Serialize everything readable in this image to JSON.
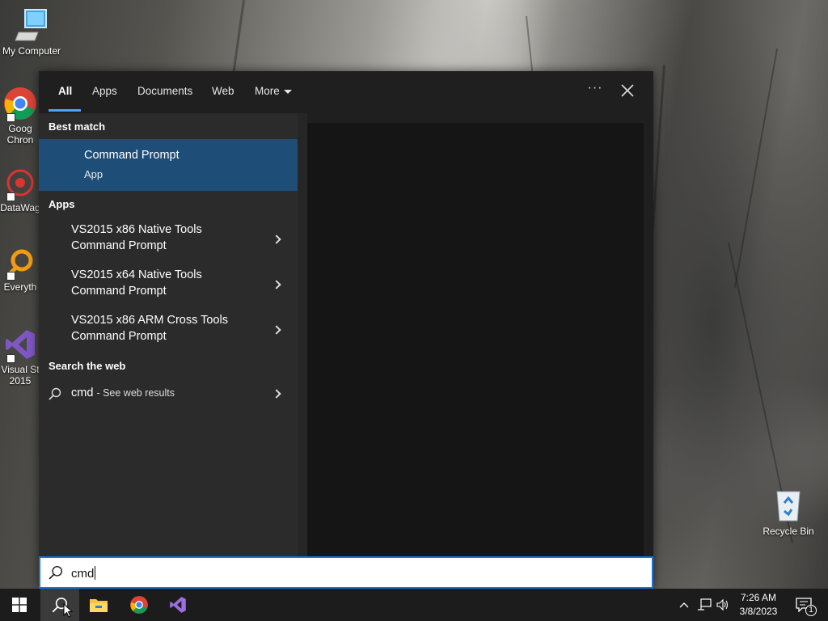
{
  "desktop": {
    "icons": [
      {
        "label": "My Computer"
      },
      {
        "label": "Goog Chron"
      },
      {
        "label": "DataWag"
      },
      {
        "label": "Everyth"
      },
      {
        "label": "Visual St 2015"
      },
      {
        "label": "Recycle Bin"
      }
    ]
  },
  "search_panel": {
    "tabs": [
      {
        "label": "All",
        "active": true
      },
      {
        "label": "Apps"
      },
      {
        "label": "Documents"
      },
      {
        "label": "Web"
      },
      {
        "label": "More"
      }
    ],
    "more_options_icon": "ellipsis-icon",
    "close_icon": "close-icon",
    "best_match": {
      "heading": "Best match",
      "title": "Command Prompt",
      "subtitle": "App"
    },
    "apps": {
      "heading": "Apps",
      "items": [
        {
          "line1": "VS2015 x86 Native Tools",
          "line2": "Command Prompt"
        },
        {
          "line1": "VS2015 x64 Native Tools",
          "line2": "Command Prompt"
        },
        {
          "line1": "VS2015 x86 ARM Cross Tools",
          "line2": "Command Prompt"
        }
      ]
    },
    "web": {
      "heading": "Search the web",
      "query": "cmd",
      "hint": "- See web results"
    },
    "search_box": {
      "value": "cmd"
    }
  },
  "taskbar": {
    "time": "7:26 AM",
    "date": "3/8/2023",
    "notifications_count": "1"
  },
  "colors": {
    "accent": "#4aa3ff",
    "best_match_bg": "#1e4e78",
    "panel_bg": "#2b2b2b"
  }
}
